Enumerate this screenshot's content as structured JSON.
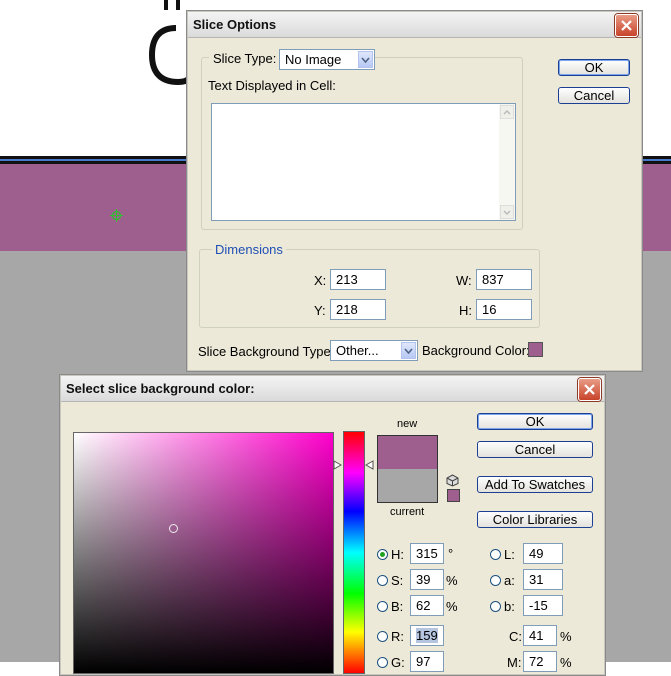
{
  "slice_options": {
    "title": "Slice Options",
    "slice_type_label": "Slice Type:",
    "slice_type_value": "No Image",
    "text_cell_label": "Text Displayed in Cell:",
    "text_cell_value": "",
    "ok_label": "OK",
    "cancel_label": "Cancel",
    "dimensions_label": "Dimensions",
    "x_label": "X:",
    "x_value": "213",
    "y_label": "Y:",
    "y_value": "218",
    "w_label": "W:",
    "w_value": "837",
    "h_label": "H:",
    "h_value": "16",
    "bg_type_label": "Slice Background Type:",
    "bg_type_value": "Other...",
    "bg_color_label": "Background Color:",
    "bg_color": "#9e5f8f"
  },
  "color_picker": {
    "title": "Select slice background color:",
    "ok_label": "OK",
    "cancel_label": "Cancel",
    "add_swatches_label": "Add To Swatches",
    "color_libraries_label": "Color Libraries",
    "new_label": "new",
    "current_label": "current",
    "new_color": "#9e5f8f",
    "current_color": "#a7a7a7",
    "hue_color": "#ff00cc",
    "selected_radio": "H",
    "H": {
      "label": "H:",
      "value": "315",
      "unit": "°"
    },
    "S": {
      "label": "S:",
      "value": "39",
      "unit": "%"
    },
    "B": {
      "label": "B:",
      "value": "62",
      "unit": "%"
    },
    "R": {
      "label": "R:",
      "value": "159"
    },
    "G": {
      "label": "G:",
      "value": "97"
    },
    "L": {
      "label": "L:",
      "value": "49"
    },
    "a": {
      "label": "a:",
      "value": "31"
    },
    "b": {
      "label": "b:",
      "value": "-15"
    },
    "C": {
      "label": "C:",
      "value": "41",
      "unit": "%"
    },
    "M": {
      "label": "M:",
      "value": "72",
      "unit": "%"
    }
  }
}
